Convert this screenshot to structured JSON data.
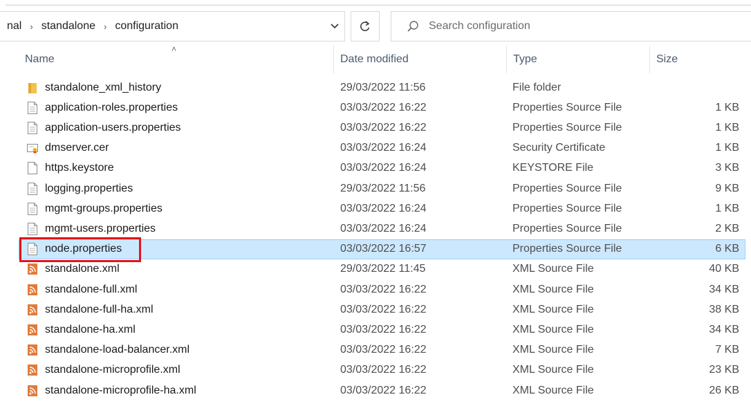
{
  "breadcrumb": {
    "items": [
      "nal",
      "standalone",
      "configuration"
    ]
  },
  "search": {
    "placeholder": "Search configuration"
  },
  "columns": {
    "name": "Name",
    "date": "Date modified",
    "type": "Type",
    "size": "Size"
  },
  "files": [
    {
      "name": "standalone_xml_history",
      "date": "29/03/2022 11:56",
      "type": "File folder",
      "size": "",
      "icon": "folder-icon"
    },
    {
      "name": "application-roles.properties",
      "date": "03/03/2022 16:22",
      "type": "Properties Source File",
      "size": "1 KB",
      "icon": "properties-file-icon"
    },
    {
      "name": "application-users.properties",
      "date": "03/03/2022 16:22",
      "type": "Properties Source File",
      "size": "1 KB",
      "icon": "properties-file-icon"
    },
    {
      "name": "dmserver.cer",
      "date": "03/03/2022 16:24",
      "type": "Security Certificate",
      "size": "1 KB",
      "icon": "certificate-icon"
    },
    {
      "name": "https.keystore",
      "date": "03/03/2022 16:24",
      "type": "KEYSTORE File",
      "size": "3 KB",
      "icon": "blank-file-icon"
    },
    {
      "name": "logging.properties",
      "date": "29/03/2022 11:56",
      "type": "Properties Source File",
      "size": "9 KB",
      "icon": "properties-file-icon"
    },
    {
      "name": "mgmt-groups.properties",
      "date": "03/03/2022 16:24",
      "type": "Properties Source File",
      "size": "1 KB",
      "icon": "properties-file-icon"
    },
    {
      "name": "mgmt-users.properties",
      "date": "03/03/2022 16:24",
      "type": "Properties Source File",
      "size": "2 KB",
      "icon": "properties-file-icon"
    },
    {
      "name": "node.properties",
      "date": "03/03/2022 16:57",
      "type": "Properties Source File",
      "size": "6 KB",
      "icon": "properties-file-icon",
      "selected": true
    },
    {
      "name": "standalone.xml",
      "date": "29/03/2022 11:45",
      "type": "XML Source File",
      "size": "40 KB",
      "icon": "xml-file-icon"
    },
    {
      "name": "standalone-full.xml",
      "date": "03/03/2022 16:22",
      "type": "XML Source File",
      "size": "34 KB",
      "icon": "xml-file-icon"
    },
    {
      "name": "standalone-full-ha.xml",
      "date": "03/03/2022 16:22",
      "type": "XML Source File",
      "size": "38 KB",
      "icon": "xml-file-icon"
    },
    {
      "name": "standalone-ha.xml",
      "date": "03/03/2022 16:22",
      "type": "XML Source File",
      "size": "34 KB",
      "icon": "xml-file-icon"
    },
    {
      "name": "standalone-load-balancer.xml",
      "date": "03/03/2022 16:22",
      "type": "XML Source File",
      "size": "7 KB",
      "icon": "xml-file-icon"
    },
    {
      "name": "standalone-microprofile.xml",
      "date": "03/03/2022 16:22",
      "type": "XML Source File",
      "size": "23 KB",
      "icon": "xml-file-icon"
    },
    {
      "name": "standalone-microprofile-ha.xml",
      "date": "03/03/2022 16:22",
      "type": "XML Source File",
      "size": "26 KB",
      "icon": "xml-file-icon"
    }
  ],
  "colors": {
    "selection_bg": "#cce8ff",
    "selection_border": "#99d1ff",
    "highlight_box": "#e1151a",
    "folder": "#f2c14e",
    "xml_icon": "#e07b39"
  }
}
